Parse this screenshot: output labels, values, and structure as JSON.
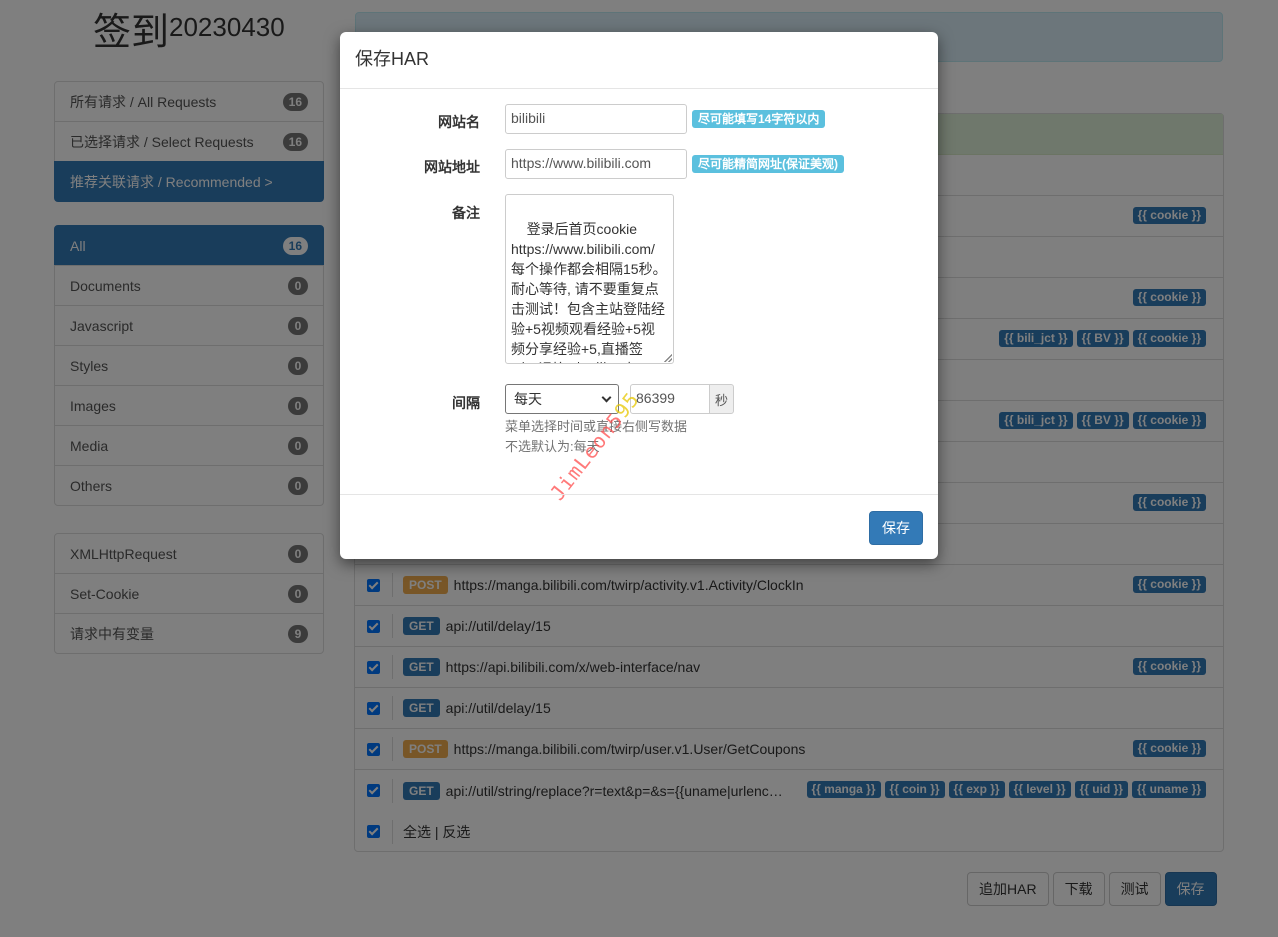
{
  "page": {
    "title": "签到",
    "version": "20230430"
  },
  "sidebar": {
    "group1": [
      {
        "label": "所有请求 / All Requests",
        "count": "16",
        "active": false
      },
      {
        "label": "已选择请求 / Select Requests",
        "count": "16",
        "active": false
      },
      {
        "label": "推荐关联请求 / Recommended >",
        "count": "",
        "active": true
      }
    ],
    "group2": [
      {
        "label": "All",
        "count": "16",
        "active": true
      },
      {
        "label": "Documents",
        "count": "0",
        "active": false
      },
      {
        "label": "Javascript",
        "count": "0",
        "active": false
      },
      {
        "label": "Styles",
        "count": "0",
        "active": false
      },
      {
        "label": "Images",
        "count": "0",
        "active": false
      },
      {
        "label": "Media",
        "count": "0",
        "active": false
      },
      {
        "label": "Others",
        "count": "0",
        "active": false
      }
    ],
    "group3": [
      {
        "label": "XMLHttpRequest",
        "count": "0",
        "active": false
      },
      {
        "label": "Set-Cookie",
        "count": "0",
        "active": false
      },
      {
        "label": "请求中有变量",
        "count": "9",
        "active": false
      }
    ]
  },
  "requests": [
    {
      "checked": true,
      "method": "",
      "url": "",
      "tags": []
    },
    {
      "checked": true,
      "method": "",
      "url": "",
      "tags": [
        "{{ cookie }}"
      ]
    },
    {
      "checked": true,
      "method": "",
      "url": "",
      "tags": []
    },
    {
      "checked": true,
      "method": "",
      "url": "",
      "tags": [
        "{{ cookie }}"
      ]
    },
    {
      "checked": true,
      "method": "",
      "url": "",
      "tags": [
        "{{ bili_jct }}",
        "{{ BV }}",
        "{{ cookie }}"
      ]
    },
    {
      "checked": true,
      "method": "",
      "url": "",
      "tags": []
    },
    {
      "checked": true,
      "method": "",
      "url": "",
      "tags": [
        "{{ bili_jct }}",
        "{{ BV }}",
        "{{ cookie }}"
      ]
    },
    {
      "checked": true,
      "method": "",
      "url": "",
      "tags": []
    },
    {
      "checked": true,
      "method": "",
      "url": "",
      "tags": [
        "{{ cookie }}"
      ]
    },
    {
      "checked": true,
      "method": "",
      "url": "",
      "tags": []
    },
    {
      "checked": true,
      "method": "POST",
      "url": "https://manga.bilibili.com/twirp/activity.v1.Activity/ClockIn",
      "tags": [
        "{{ cookie }}"
      ]
    },
    {
      "checked": true,
      "method": "GET",
      "url": "api://util/delay/15",
      "tags": []
    },
    {
      "checked": true,
      "method": "GET",
      "url": "https://api.bilibili.com/x/web-interface/nav",
      "tags": [
        "{{ cookie }}"
      ]
    },
    {
      "checked": true,
      "method": "GET",
      "url": "api://util/delay/15",
      "tags": []
    },
    {
      "checked": true,
      "method": "POST",
      "url": "https://manga.bilibili.com/twirp/user.v1.User/GetCoupons",
      "tags": [
        "{{ cookie }}"
      ]
    },
    {
      "checked": true,
      "method": "GET",
      "url": "api://util/string/replace?r=text&p=&s={{uname|urlencode}}",
      "tags": [
        "{{ manga }}",
        "{{ coin }}",
        "{{ exp }}",
        "{{ level }}",
        "{{ uid }}",
        "{{ uname }}"
      ]
    }
  ],
  "select_all": "全选 | 反选",
  "buttons": {
    "append_har": "追加HAR",
    "download": "下载",
    "test": "测试",
    "save": "保存"
  },
  "modal": {
    "title": "保存HAR",
    "site_name_label": "网站名",
    "site_name_value": "bilibili",
    "site_name_hint": "尽可能填写14字符以内",
    "site_url_label": "网站地址",
    "site_url_value": "https://www.bilibili.com",
    "site_url_hint": "尽可能精简网址(保证美观)",
    "note_label": "备注",
    "note_value": "登录后首页cookie\nhttps://www.bilibili.com/\n每个操作都会相隔15秒。耐心等待, 请不要重复点击测试！包含主站登陆经验+5视频观看经验+5视频分享经验+5,直播签到,B漫签到。带日志",
    "interval_label": "间隔",
    "interval_select": "每天",
    "interval_value": "86399",
    "interval_unit": "秒",
    "help_line1": "菜单选择时间或直接右侧写数据",
    "help_line2": "不选默认为:每天",
    "save_button": "保存",
    "watermark_main": "JimLeon5",
    "watermark_tail": "95"
  }
}
